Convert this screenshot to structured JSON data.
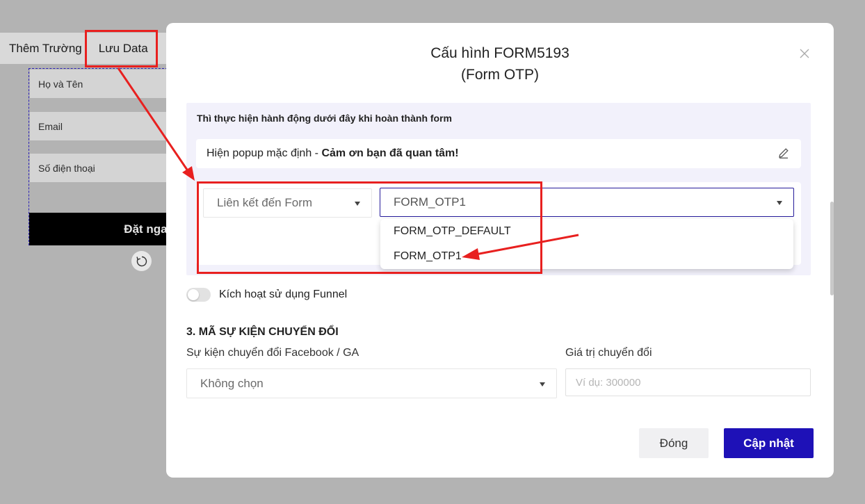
{
  "editor": {
    "toolbar": {
      "add_field": "Thêm Trường",
      "save_data": "Lưu Data"
    },
    "form_fields": [
      "Họ và Tên",
      "Email",
      "Số điện thoại"
    ],
    "submit_button": "Đặt ngay"
  },
  "modal": {
    "title_line1": "Cấu hình FORM5193",
    "title_line2": "(Form OTP)",
    "action_heading": "Thì thực hiện hành động dưới đây khi hoàn thành form",
    "popup_prefix": "Hiện popup mặc định - ",
    "popup_message": "Cảm ơn bạn đã quan tâm!",
    "link_type": "Liên kết đến Form",
    "form_selected": "FORM_OTP1",
    "form_options": [
      "FORM_OTP_DEFAULT",
      "FORM_OTP1"
    ],
    "funnel_toggle_label": "Kích hoạt sử dụng Funnel",
    "funnel_enabled": false,
    "section3_title": "3. MÃ SỰ KIỆN CHUYỂN ĐỔI",
    "conversion_event_label": "Sự kiện chuyển đổi Facebook / GA",
    "conversion_event_value": "Không chọn",
    "conversion_value_label": "Giá trị chuyển đổi",
    "conversion_value_placeholder": "Ví dụ: 300000",
    "close_button": "Đóng",
    "update_button": "Cập nhật"
  },
  "colors": {
    "primary": "#1e11b7",
    "annotation": "#e8201f",
    "overlay": "#b3b3b3"
  }
}
